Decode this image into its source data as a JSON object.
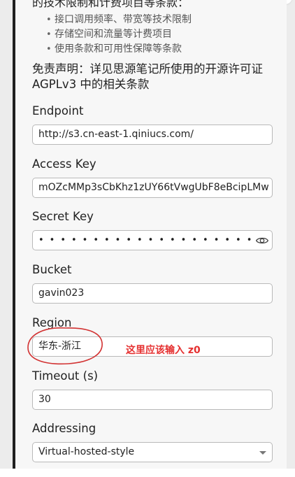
{
  "intro": {
    "tail_text": "的技术限制和计费项目等条款："
  },
  "bullets": [
    "接口调用频率、带宽等技术限制",
    "存储空间和流量等计费项目",
    "使用条款和可用性保障等条款"
  ],
  "disclaimer": "免责声明：详见思源笔记所使用的开源许可证 AGPLv3 中的相关条款",
  "fields": {
    "endpoint": {
      "label": "Endpoint",
      "value": "http://s3.cn-east-1.qiniucs.com/"
    },
    "access_key": {
      "label": "Access Key",
      "value": "mOZcMMp3sCbKhz1zUY66tVwgUbF8eBcipLMw"
    },
    "secret_key": {
      "label": "Secret Key",
      "value": "••••••••••••••••••••"
    },
    "bucket": {
      "label": "Bucket",
      "value": "gavin023"
    },
    "region": {
      "label": "Region",
      "value": "华东-浙江"
    },
    "timeout": {
      "label": "Timeout (s)",
      "value": "30"
    },
    "addressing": {
      "label": "Addressing",
      "value": "Virtual-hosted-style"
    }
  },
  "annotation": {
    "text": "这里应该输入  z0",
    "color": "#e53030"
  },
  "icons": {
    "secret_toggle": "eye-icon",
    "addressing_dropdown": "chevron-down-icon"
  }
}
